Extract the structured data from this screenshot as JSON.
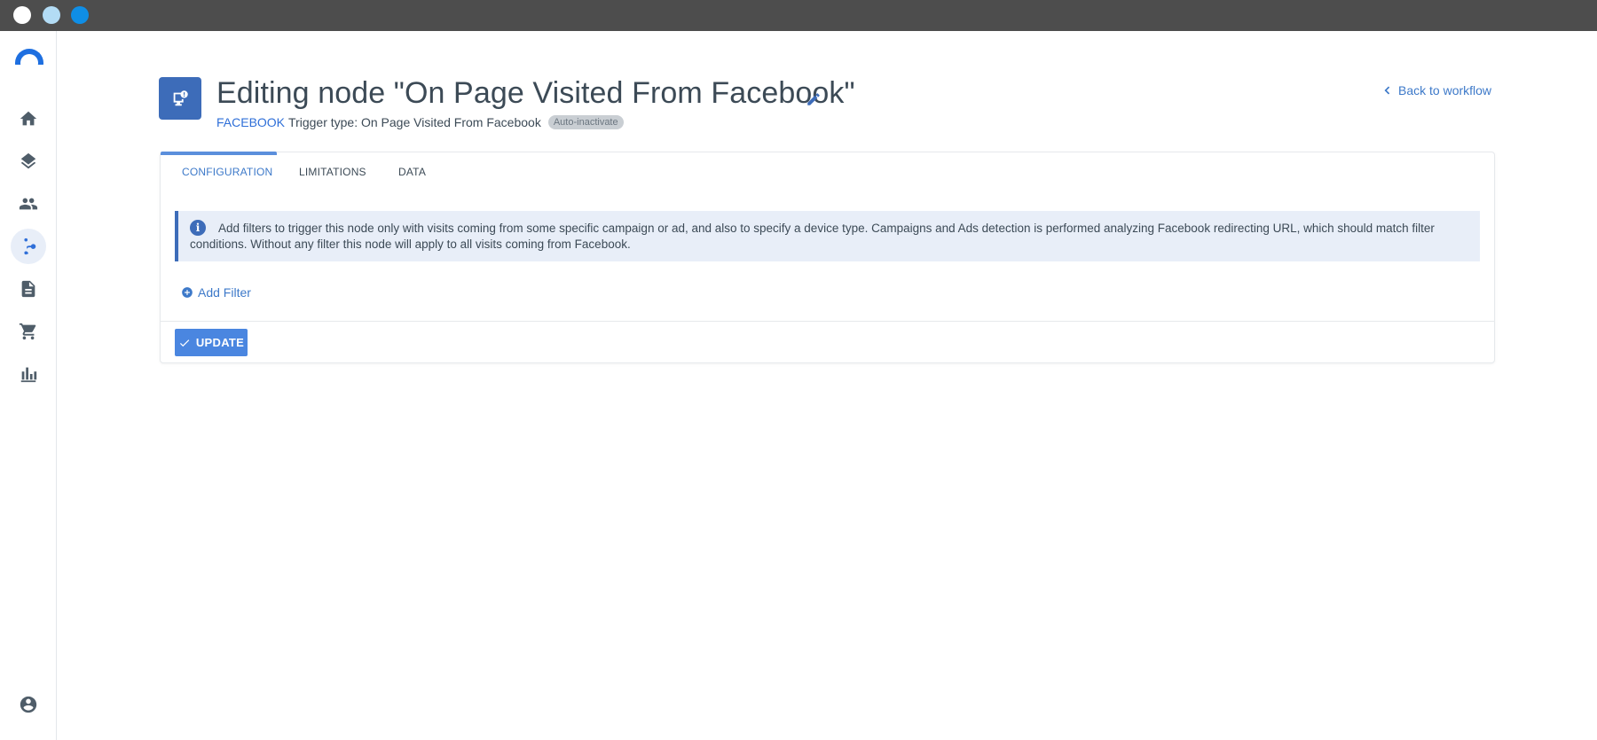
{
  "window": {
    "controls": [
      "close",
      "minimize",
      "maximize"
    ]
  },
  "sidebar": {
    "items": [
      {
        "name": "home",
        "icon": "home-icon",
        "active": false
      },
      {
        "name": "layers",
        "icon": "layers-icon",
        "active": false
      },
      {
        "name": "contacts",
        "icon": "people-icon",
        "active": false
      },
      {
        "name": "workflows",
        "icon": "workflow-icon",
        "active": true
      },
      {
        "name": "documents",
        "icon": "document-icon",
        "active": false
      },
      {
        "name": "commerce",
        "icon": "cart-icon",
        "active": false
      },
      {
        "name": "reports",
        "icon": "bar-chart-icon",
        "active": false
      }
    ],
    "account_icon": "account-icon"
  },
  "header": {
    "title": "Editing node \"On Page Visited From Facebook\"",
    "source": "FACEBOOK",
    "trigger_text": "Trigger type: On Page Visited From Facebook",
    "badge": "Auto-inactivate",
    "back_link": "Back to workflow",
    "accent_color": "#3d6cb9"
  },
  "tabs": [
    {
      "label": "CONFIGURATION",
      "active": true
    },
    {
      "label": "LIMITATIONS",
      "active": false
    },
    {
      "label": "DATA",
      "active": false
    }
  ],
  "info": {
    "text": "Add filters to trigger this node only with visits coming from some specific campaign or ad, and also to specify a device type. Campaigns and Ads detection is performed analyzing Facebook redirecting URL, which should match filter conditions. Without any filter this node will apply to all visits coming from Facebook."
  },
  "actions": {
    "add_filter": "Add Filter",
    "update": "UPDATE"
  }
}
